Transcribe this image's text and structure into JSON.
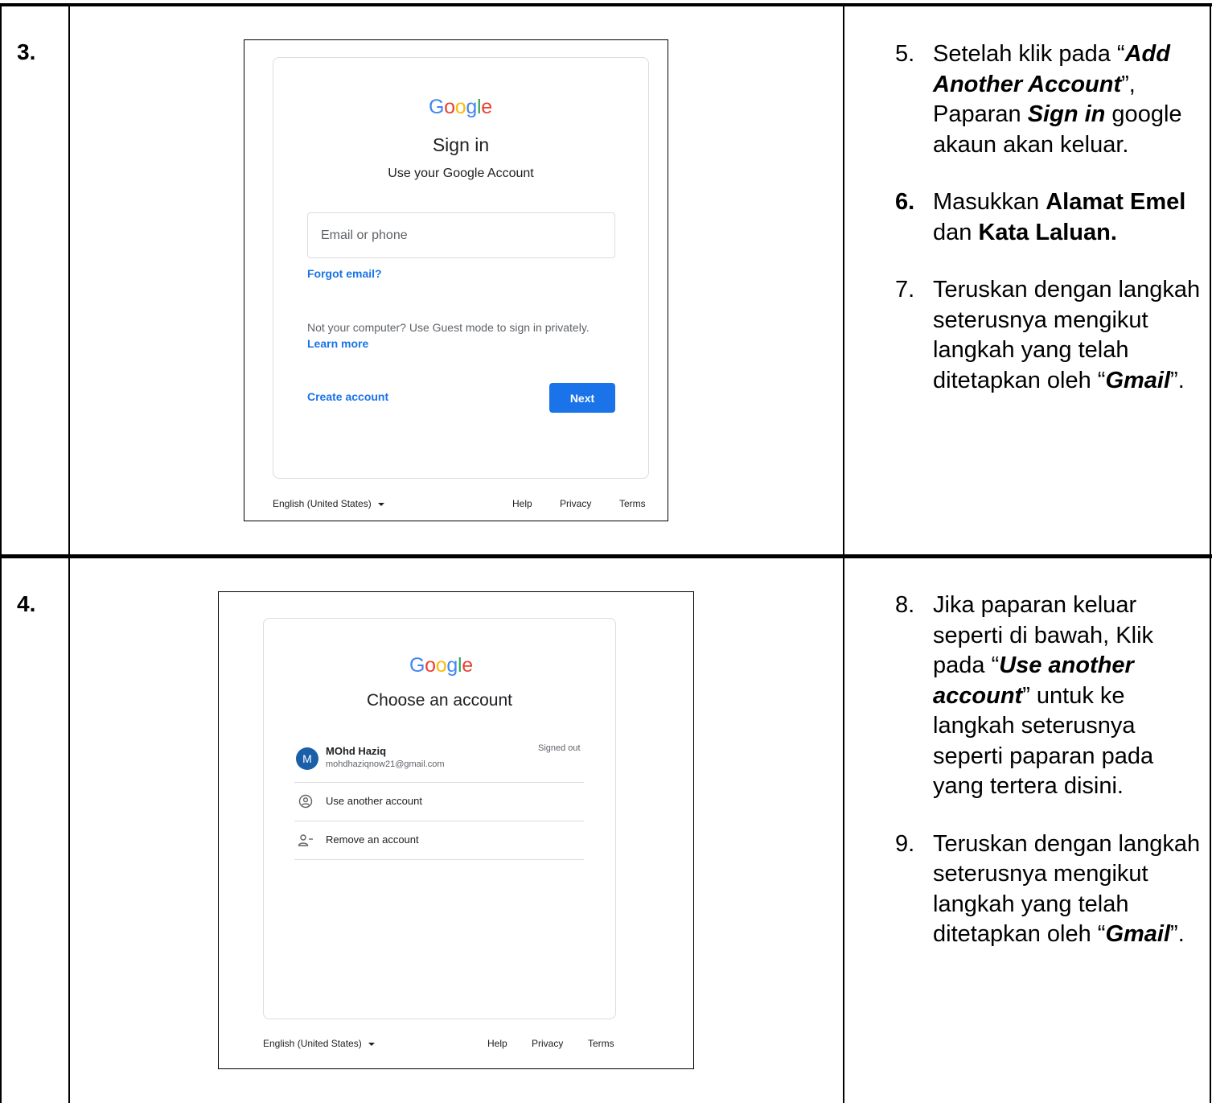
{
  "rows": [
    {
      "step_number": "3.",
      "screenshot": {
        "logo": "Google",
        "title": "Sign in",
        "subtitle": "Use your Google Account",
        "email_placeholder": "Email or phone",
        "forgot_email": "Forgot email?",
        "guest_text": "Not your computer? Use Guest mode to sign in privately.",
        "learn_more": "Learn more",
        "create_account": "Create account",
        "next": "Next",
        "language": "English (United States)",
        "help": "Help",
        "privacy": "Privacy",
        "terms": "Terms"
      },
      "instructions": [
        {
          "num": "5.",
          "pre": "Setelah klik pada “",
          "em": "Add Another Account",
          "post": "”, Paparan ",
          "em2": "Sign in",
          "post2": " google akaun akan keluar."
        },
        {
          "num": "6.",
          "pre": "Masukkan ",
          "b1": "Alamat Emel",
          "mid": " dan ",
          "b2": "Kata Laluan."
        },
        {
          "num": "7.",
          "pre": "Teruskan dengan langkah seterusnya mengikut langkah yang telah ditetapkan oleh “",
          "em": "Gmail",
          "post": "”."
        }
      ]
    },
    {
      "step_number": "4.",
      "screenshot": {
        "logo": "Google",
        "title": "Choose an account",
        "avatar_letter": "M",
        "account_name": "MOhd Haziq",
        "account_email": "mohdhaziqnow21@gmail.com",
        "account_status": "Signed out",
        "use_another": "Use another account",
        "remove_account": "Remove an account",
        "language": "English (United States)",
        "help": "Help",
        "privacy": "Privacy",
        "terms": "Terms",
        "icons": [
          "person-circle-icon",
          "person-remove-icon"
        ]
      },
      "instructions": [
        {
          "num": "8.",
          "pre": "Jika paparan keluar seperti di bawah, Klik pada “",
          "em": "Use another account",
          "post": "” untuk ke langkah seterusnya seperti paparan pada yang tertera disini."
        },
        {
          "num": "9.",
          "pre": "Teruskan dengan langkah seterusnya mengikut langkah yang telah ditetapkan oleh “",
          "em": "Gmail",
          "post": "”."
        }
      ]
    }
  ]
}
